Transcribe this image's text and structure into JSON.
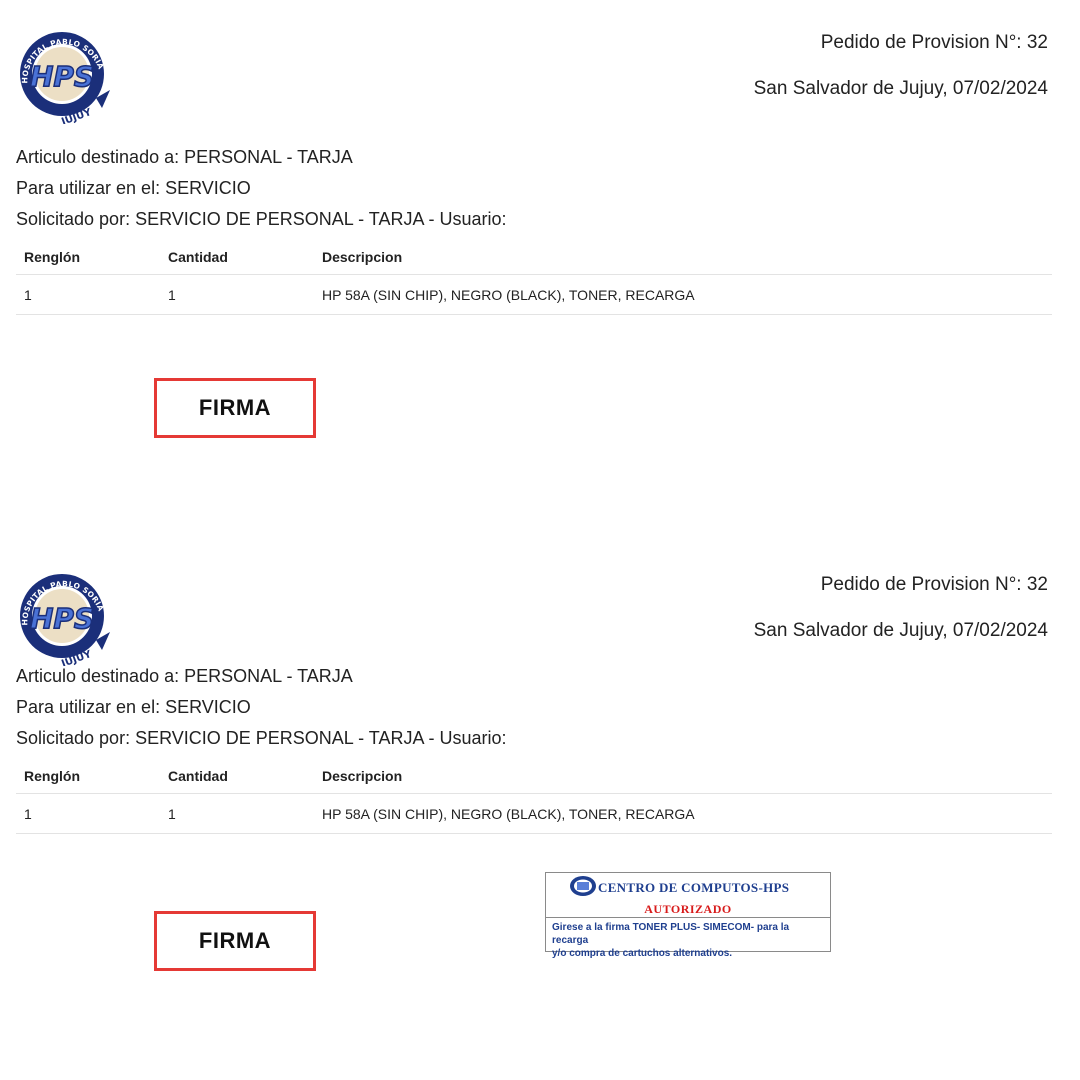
{
  "logo": {
    "ring_text": "HOSPITAL PABLO SORIA",
    "monogram": "HPS",
    "bottom_text": "JUJUY",
    "colors": {
      "navy": "#1b2f7a",
      "blue": "#4a72d6",
      "gold": "#c9a45a"
    }
  },
  "header": {
    "order_number": "Pedido de Provision N°: 32",
    "place_date": "San Salvador de Jujuy, 07/02/2024"
  },
  "info": {
    "destined": "Articulo destinado a: PERSONAL - TARJA",
    "use_in": "Para utilizar en el: SERVICIO",
    "requested_by": "Solicitado por: SERVICIO DE PERSONAL - TARJA - Usuario:"
  },
  "table": {
    "headers": [
      "Renglón",
      "Cantidad",
      "Descripcion"
    ],
    "rows": [
      [
        "1",
        "1",
        "HP 58A (SIN CHIP), NEGRO (BLACK), TONER, RECARGA"
      ]
    ]
  },
  "signature_label": "FIRMA",
  "stamp": {
    "title": "CENTRO DE COMPUTOS-HPS",
    "authorized": "AUTORIZADO",
    "note_line1": "Girese a la firma TONER PLUS- SIMECOM- para la recarga",
    "note_line2": "y/o compra de cartuchos alternativos."
  },
  "colors": {
    "firma_border": "#e53935",
    "stamp_red": "#d81b1b",
    "stamp_blue": "#1f3f8f"
  }
}
